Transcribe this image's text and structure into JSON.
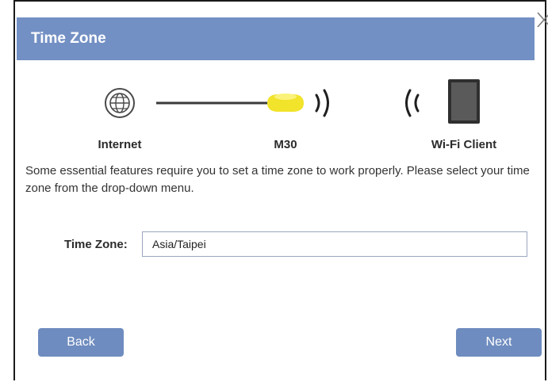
{
  "header": {
    "title": "Time Zone"
  },
  "diagram": {
    "nodes": [
      {
        "label": "Internet",
        "icon": "globe-icon"
      },
      {
        "label": "M30",
        "icon": "router-icon"
      },
      {
        "label": "Wi-Fi Client",
        "icon": "tablet-icon"
      }
    ]
  },
  "description": "Some essential features require you to set a time zone to work properly. Please select your time zone from the drop-down menu.",
  "form": {
    "time_zone_label": "Time Zone:",
    "time_zone_value": "Asia/Taipei"
  },
  "buttons": {
    "back_label": "Back",
    "next_label": "Next"
  },
  "colors": {
    "header_bg": "#7390c4",
    "button_bg": "#6e8cbf",
    "router_yellow": "#f2e32b"
  }
}
